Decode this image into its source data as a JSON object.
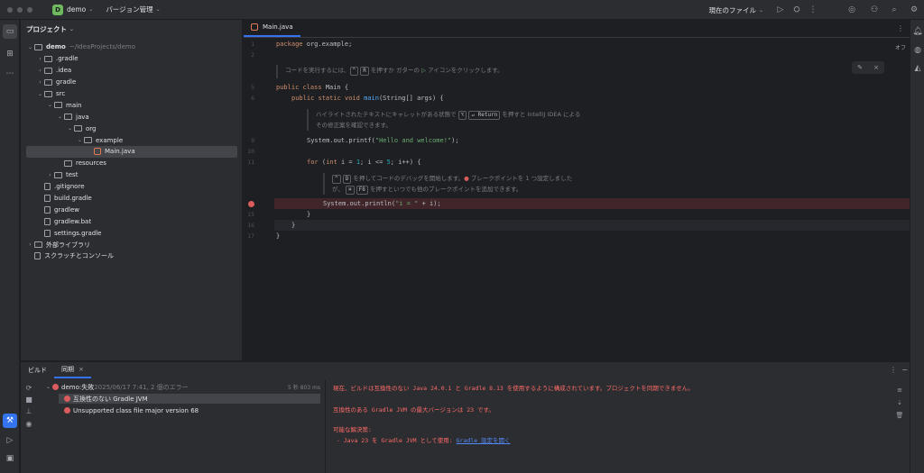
{
  "titlebar": {
    "project_badge": "D",
    "project_name": "demo",
    "vcs_label": "バージョン管理",
    "run_config": "現在のファイル"
  },
  "project_panel": {
    "title": "プロジェクト",
    "tree": [
      {
        "label": "demo",
        "extra": "~/IdeaProjects/demo",
        "depth": 0,
        "arrow": "open",
        "kind": "folder",
        "bold": true
      },
      {
        "label": ".gradle",
        "depth": 1,
        "arrow": "closed",
        "kind": "folder"
      },
      {
        "label": ".idea",
        "depth": 1,
        "arrow": "closed",
        "kind": "folder"
      },
      {
        "label": "gradle",
        "depth": 1,
        "arrow": "closed",
        "kind": "folder"
      },
      {
        "label": "src",
        "depth": 1,
        "arrow": "open",
        "kind": "folder"
      },
      {
        "label": "main",
        "depth": 2,
        "arrow": "open",
        "kind": "folder"
      },
      {
        "label": "java",
        "depth": 3,
        "arrow": "open",
        "kind": "folder"
      },
      {
        "label": "org",
        "depth": 4,
        "arrow": "open",
        "kind": "folder"
      },
      {
        "label": "example",
        "depth": 5,
        "arrow": "open",
        "kind": "folder"
      },
      {
        "label": "Main.java",
        "depth": 6,
        "arrow": "none",
        "kind": "java",
        "selected": true
      },
      {
        "label": "resources",
        "depth": 3,
        "arrow": "none",
        "kind": "folder"
      },
      {
        "label": "test",
        "depth": 2,
        "arrow": "closed",
        "kind": "folder"
      },
      {
        "label": ".gitignore",
        "depth": 1,
        "arrow": "none",
        "kind": "file"
      },
      {
        "label": "build.gradle",
        "depth": 1,
        "arrow": "none",
        "kind": "file"
      },
      {
        "label": "gradlew",
        "depth": 1,
        "arrow": "none",
        "kind": "file"
      },
      {
        "label": "gradlew.bat",
        "depth": 1,
        "arrow": "none",
        "kind": "file"
      },
      {
        "label": "settings.gradle",
        "depth": 1,
        "arrow": "none",
        "kind": "file"
      },
      {
        "label": "外部ライブラリ",
        "depth": 0,
        "arrow": "closed",
        "kind": "folder"
      },
      {
        "label": "スクラッチとコンソール",
        "depth": 0,
        "arrow": "none",
        "kind": "file"
      }
    ]
  },
  "editor": {
    "tab_label": "Main.java",
    "off_label": "オフ",
    "line_numbers": [
      "1",
      "2",
      "",
      "5",
      "6",
      "",
      "",
      "9",
      "10",
      "11",
      "",
      "",
      "",
      "15",
      "16",
      "17"
    ],
    "code": {
      "l1_kw": "package",
      "l1_rest": " org.example;",
      "l5_kw": "public class",
      "l5_rest": " Main {",
      "l6_kw": "public static void",
      "l6_fn": " main",
      "l6_rest": "(String[] args) {",
      "l9_pre": "System.out.printf(",
      "l9_str": "\"Hello and welcome!\"",
      "l9_post": ");",
      "l11_kw": "for",
      "l11_a": " (",
      "l11_kw2": "int",
      "l11_b": " i = ",
      "l11_n1": "1",
      "l11_c": "; i <= ",
      "l11_n2": "5",
      "l11_d": "; i++) {",
      "l14_pre": "System.out.println(",
      "l14_str": "\"i = \"",
      "l14_post": " + i);",
      "l15": "}",
      "l16": "}",
      "l17": "}"
    },
    "hints": {
      "h1_a": "コードを実行するには、",
      "h1_k1": "^",
      "h1_k2": "R",
      "h1_b": " を押すか ガターの ",
      "h1_c": " アイコンをクリックします。",
      "h2_a": "ハイライトされたテキストにキャレットがある状態で ",
      "h2_k1": "⌥",
      "h2_k2": "↵ Return",
      "h2_b": " を押すと IntelliJ IDEA による",
      "h2_line2": "その修正案を確認できます。",
      "h3_k1": "^",
      "h3_k2": "D",
      "h3_a": " を押してコードのデバッグを開始します。",
      "h3_b": " ブレークポイントを 1 つ設定しました",
      "h3_line2_a": "が、",
      "h3_k3": "⌘",
      "h3_k4": "F8",
      "h3_line2_b": " を押すといつでも他のブレークポイントを追加できます。"
    }
  },
  "build_panel": {
    "tab_build": "ビルド",
    "tab_sync": "同期",
    "root_label": "demo:",
    "root_status": " 失敗",
    "root_meta": " 2025/06/17 7:41, 2 個のエラー",
    "duration": "5 秒 803 ms",
    "errors": [
      "互換性のない Gradle JVM",
      "Unsupported class file major version 68"
    ],
    "output": {
      "line1": "現在、ビルドは互換性のない Java 24.0.1 と Gradle 8.13 を使用するように構成されています。プロジェクトを同期できません。",
      "line2": "互換性のある Gradle JVM の最大バージョンは 23 です。",
      "line3": "可能な解決策:",
      "line4_a": " - Java 23 を Gradle JVM として使用: ",
      "line4_link": "Gradle 設定を開く"
    }
  }
}
